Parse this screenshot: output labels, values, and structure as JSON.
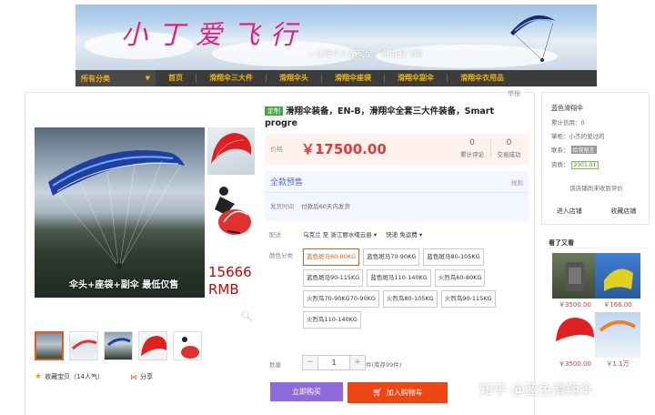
{
  "banner": {
    "title": "小丁爱飞行",
    "slogan": "—让每个人都安全，自由的飞翔"
  },
  "nav": {
    "category": "所有分类",
    "items": [
      "首页",
      "滑翔伞三大件",
      "滑翔伞头",
      "滑翔伞座袋",
      "滑翔伞副伞",
      "滑翔伞衣用品"
    ]
  },
  "report": "举报",
  "gallery": {
    "caption": "伞头+座袋+副伞  最低仅售",
    "price_note_1": "15666",
    "price_note_2": "RMB",
    "zoom_icon": "search-icon",
    "favorite": "收藏宝贝（14人气）",
    "share": "分享"
  },
  "product": {
    "tag": "定制",
    "title": "滑翔伞装备，EN-B，滑翔伞全套三大件装备，Smart progre",
    "price_label": "价格",
    "price": "￥17500.00",
    "stats": [
      {
        "num": "0",
        "label": "累计评论"
      },
      {
        "num": "0",
        "label": "交易成功"
      }
    ],
    "presale": {
      "title": "全款预售",
      "rule": "规则",
      "time_label": "发货时间",
      "time_value": "付款后60天内发货"
    },
    "delivery": {
      "label": "配送",
      "from": "乌克兰 至",
      "to": "浙江丽水缙云县",
      "express": "快递 免运费"
    },
    "options_label": "颜色分类",
    "options": [
      {
        "label": "蓝色斑马60-80KG",
        "selected": true
      },
      {
        "label": "蓝色斑马70-90KG",
        "selected": false
      },
      {
        "label": "蓝色斑马80-105KG",
        "selected": false
      },
      {
        "label": "蓝色斑马90-115KG",
        "selected": false
      },
      {
        "label": "蓝色斑马110-140KG",
        "selected": false
      },
      {
        "label": "火烈鸟60-80KG",
        "selected": false
      },
      {
        "label": "火烈鸟70-90KG70-90KG",
        "selected": false
      },
      {
        "label": "火烈鸟80-105KG",
        "selected": false
      },
      {
        "label": "火烈鸟90-115KG",
        "selected": false
      },
      {
        "label": "火烈鸟110-140KG",
        "selected": false
      }
    ],
    "quantity_label": "数量",
    "quantity": "1",
    "minus": "−",
    "plus": "+",
    "stock": "件(库存99件)",
    "buy_now": "立即购买",
    "add_cart": "加入购物车"
  },
  "shop": {
    "name": "蓝色滑翔伞",
    "credit": "累计信用：0",
    "seller": "掌柜：小杰的爱过的",
    "contact_label": "联系：",
    "contact_badge": "给我留言",
    "qual_label": "资质：",
    "qual_badge": "2001.01",
    "no_eval": "该店铺尚未收到评价",
    "enter": "进入店铺",
    "collect": "收藏店铺"
  },
  "recommend": {
    "title": "看了又看",
    "items": [
      {
        "price": "￥3500.00"
      },
      {
        "price": "￥166.00"
      },
      {
        "price": "￥3500.00"
      },
      {
        "price": "￥1.1万"
      }
    ]
  },
  "watermark": "知乎 @蓝色滑翔伞",
  "colors": {
    "accent": "#e85a1b",
    "price": "#e4393c",
    "nav_bg": "#3c3c3c",
    "nav_text": "#f0b400",
    "buy": "#8e6bda",
    "cart": "#ee4613"
  }
}
